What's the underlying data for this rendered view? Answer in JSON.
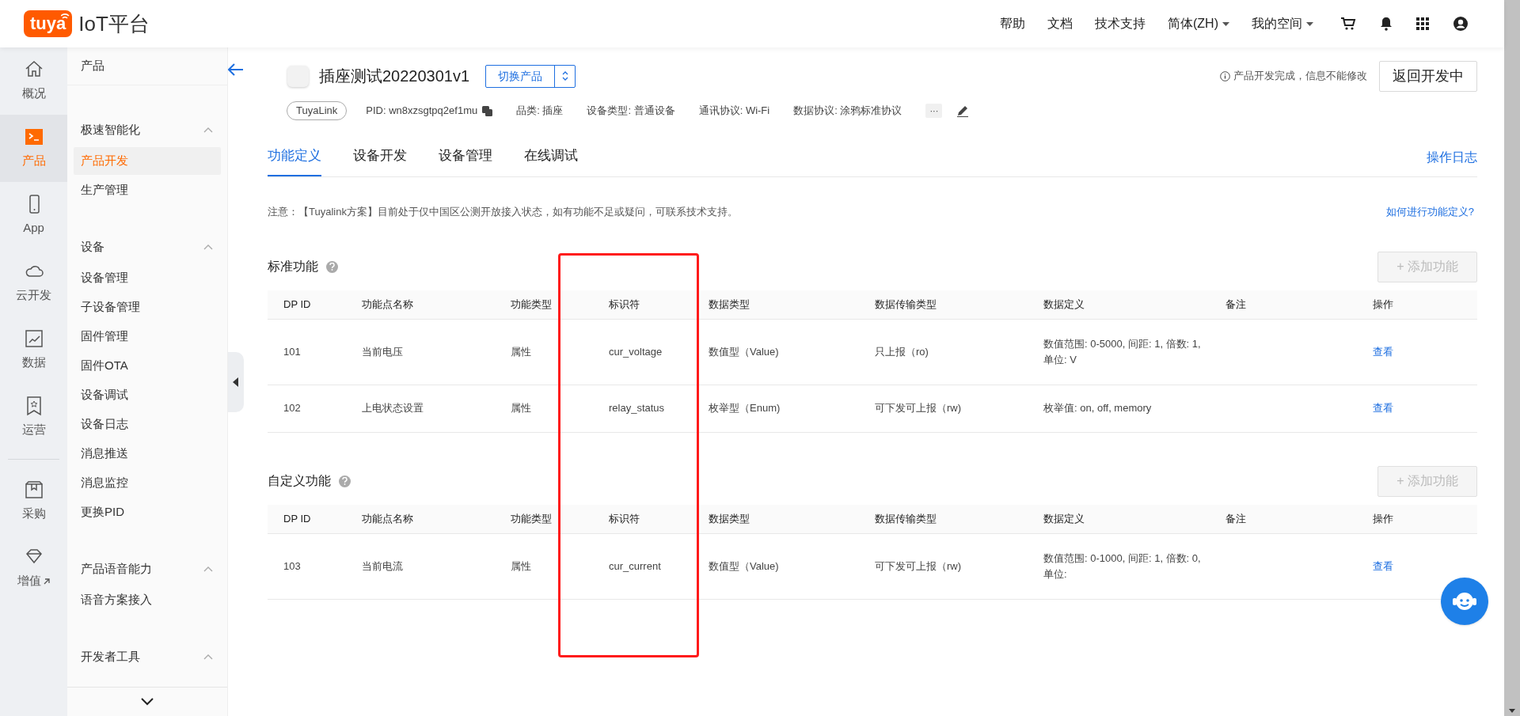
{
  "header": {
    "logo_badge": "tuya",
    "logo_text": "IoT平台",
    "nav": [
      {
        "label": "帮助",
        "kind": "link"
      },
      {
        "label": "文档",
        "kind": "link"
      },
      {
        "label": "技术支持",
        "kind": "link"
      },
      {
        "label": "简体(ZH)",
        "kind": "dropdown"
      },
      {
        "label": "我的空间",
        "kind": "dropdown"
      }
    ]
  },
  "rail": {
    "main": [
      {
        "label": "概况",
        "selected": false
      },
      {
        "label": "产品",
        "selected": true
      },
      {
        "label": "App",
        "selected": false
      },
      {
        "label": "云开发",
        "selected": false
      },
      {
        "label": "数据",
        "selected": false
      },
      {
        "label": "运营",
        "selected": false
      }
    ],
    "more": [
      {
        "label": "采购",
        "selected": false,
        "external": false
      },
      {
        "label": "增值",
        "selected": false,
        "external": true
      }
    ]
  },
  "menu": {
    "title": "产品",
    "groups": [
      {
        "label": "极速智能化",
        "expanded": true,
        "items": [
          {
            "label": "产品开发",
            "selected": true
          },
          {
            "label": "生产管理",
            "selected": false
          }
        ]
      },
      {
        "label": "设备",
        "expanded": true,
        "items": [
          {
            "label": "设备管理",
            "selected": false
          },
          {
            "label": "子设备管理",
            "selected": false
          },
          {
            "label": "固件管理",
            "selected": false
          },
          {
            "label": "固件OTA",
            "selected": false
          },
          {
            "label": "设备调试",
            "selected": false
          },
          {
            "label": "设备日志",
            "selected": false
          },
          {
            "label": "消息推送",
            "selected": false
          },
          {
            "label": "消息监控",
            "selected": false
          },
          {
            "label": "更换PID",
            "selected": false
          }
        ]
      },
      {
        "label": "产品语音能力",
        "expanded": true,
        "items": [
          {
            "label": "语音方案接入",
            "selected": false
          }
        ]
      },
      {
        "label": "开发者工具",
        "expanded": true
      }
    ]
  },
  "product": {
    "name": "插座测试20220301v1",
    "switch_button": "切换产品",
    "status_note": "产品开发完成，信息不能修改",
    "back_button": "返回开发中",
    "tag": "TuyaLink",
    "pid": "PID: wn8xzsgtpq2ef1mu",
    "meta": [
      "品类: 插座",
      "设备类型: 普通设备",
      "通讯协议: Wi-Fi",
      "数据协议: 涂鸦标准协议"
    ],
    "more_button": "···"
  },
  "tabs": [
    {
      "label": "功能定义",
      "selected": true
    },
    {
      "label": "设备开发",
      "selected": false
    },
    {
      "label": "设备管理",
      "selected": false
    },
    {
      "label": "在线调试",
      "selected": false
    }
  ],
  "log_link": "操作日志",
  "notice": "注意：【Tuyalink方案】目前处于仅中国区公测开放接入状态，如有功能不足或疑问，可联系技术支持。",
  "help_link": "如何进行功能定义?",
  "sections": [
    {
      "title": "标准功能",
      "add_button": "+ 添加功能",
      "add_disabled": true,
      "columns": [
        "DP ID",
        "功能点名称",
        "功能类型",
        "标识符",
        "数据类型",
        "数据传输类型",
        "数据定义",
        "备注",
        "操作"
      ],
      "rows": [
        {
          "cells": [
            "101",
            "当前电压",
            "属性",
            "cur_voltage",
            "数值型（Value)",
            "只上报（ro)",
            "数值范围: 0-5000, 间距: 1, 倍数: 1, 单位: V"
          ],
          "action": "查看"
        },
        {
          "cells": [
            "102",
            "上电状态设置",
            "属性",
            "relay_status",
            "枚举型（Enum)",
            "可下发可上报（rw)",
            "枚举值: on, off, memory"
          ],
          "action": "查看"
        }
      ]
    },
    {
      "title": "自定义功能",
      "add_button": "+ 添加功能",
      "add_disabled": true,
      "columns": [
        "DP ID",
        "功能点名称",
        "功能类型",
        "标识符",
        "数据类型",
        "数据传输类型",
        "数据定义",
        "备注",
        "操作"
      ],
      "rows": [
        {
          "cells": [
            "103",
            "当前电流",
            "属性",
            "cur_current",
            "数值型（Value)",
            "可下发可上报（rw)",
            "数值范围: 0-1000, 间距: 1, 倍数: 0, 单位:"
          ],
          "action": "查看"
        }
      ]
    }
  ]
}
